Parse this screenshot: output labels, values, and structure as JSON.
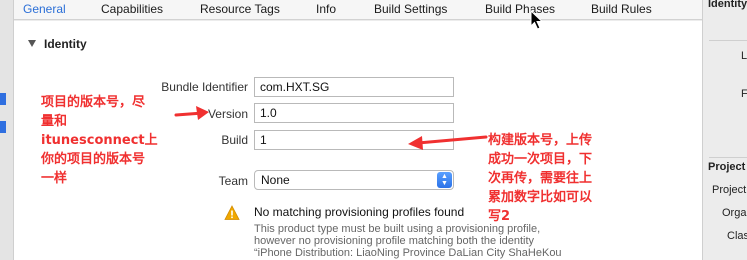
{
  "tabs": [
    "General",
    "Capabilities",
    "Resource Tags",
    "Info",
    "Build Settings",
    "Build Phases",
    "Build Rules"
  ],
  "section": {
    "title": "Identity"
  },
  "identity": {
    "bundle_identifier_label": "Bundle Identifier",
    "bundle_identifier_value": "com.HXT.SG",
    "version_label": "Version",
    "version_value": "1.0",
    "build_label": "Build",
    "build_value": "1",
    "team_label": "Team",
    "team_value": "None"
  },
  "warning": {
    "title": "No matching provisioning profiles found",
    "line1": "This product type must be built using a provisioning profile,",
    "line2": "however no provisioning profile matching both the identity",
    "line3": "“iPhone Distribution: LiaoNing Province DaLian City ShaHeKou"
  },
  "inspector": {
    "identity_header": "Identity",
    "l": "L",
    "f": "F",
    "project_header": "Project",
    "project_row": "Project",
    "org_row": "Organ",
    "class_row": "Class"
  },
  "annotations": {
    "left": [
      "项目的版本号，尽",
      "量和",
      "itunesconnect上",
      "你的项目的版本号",
      "一样"
    ],
    "right": [
      "构建版本号，上传",
      "成功一次项目，下",
      "次再传，需要往上",
      "累加数字比如可以",
      "写2"
    ]
  },
  "colors": {
    "accent": "#2b6fd7",
    "annotation": "#f03030",
    "warning": "#f0a800"
  }
}
